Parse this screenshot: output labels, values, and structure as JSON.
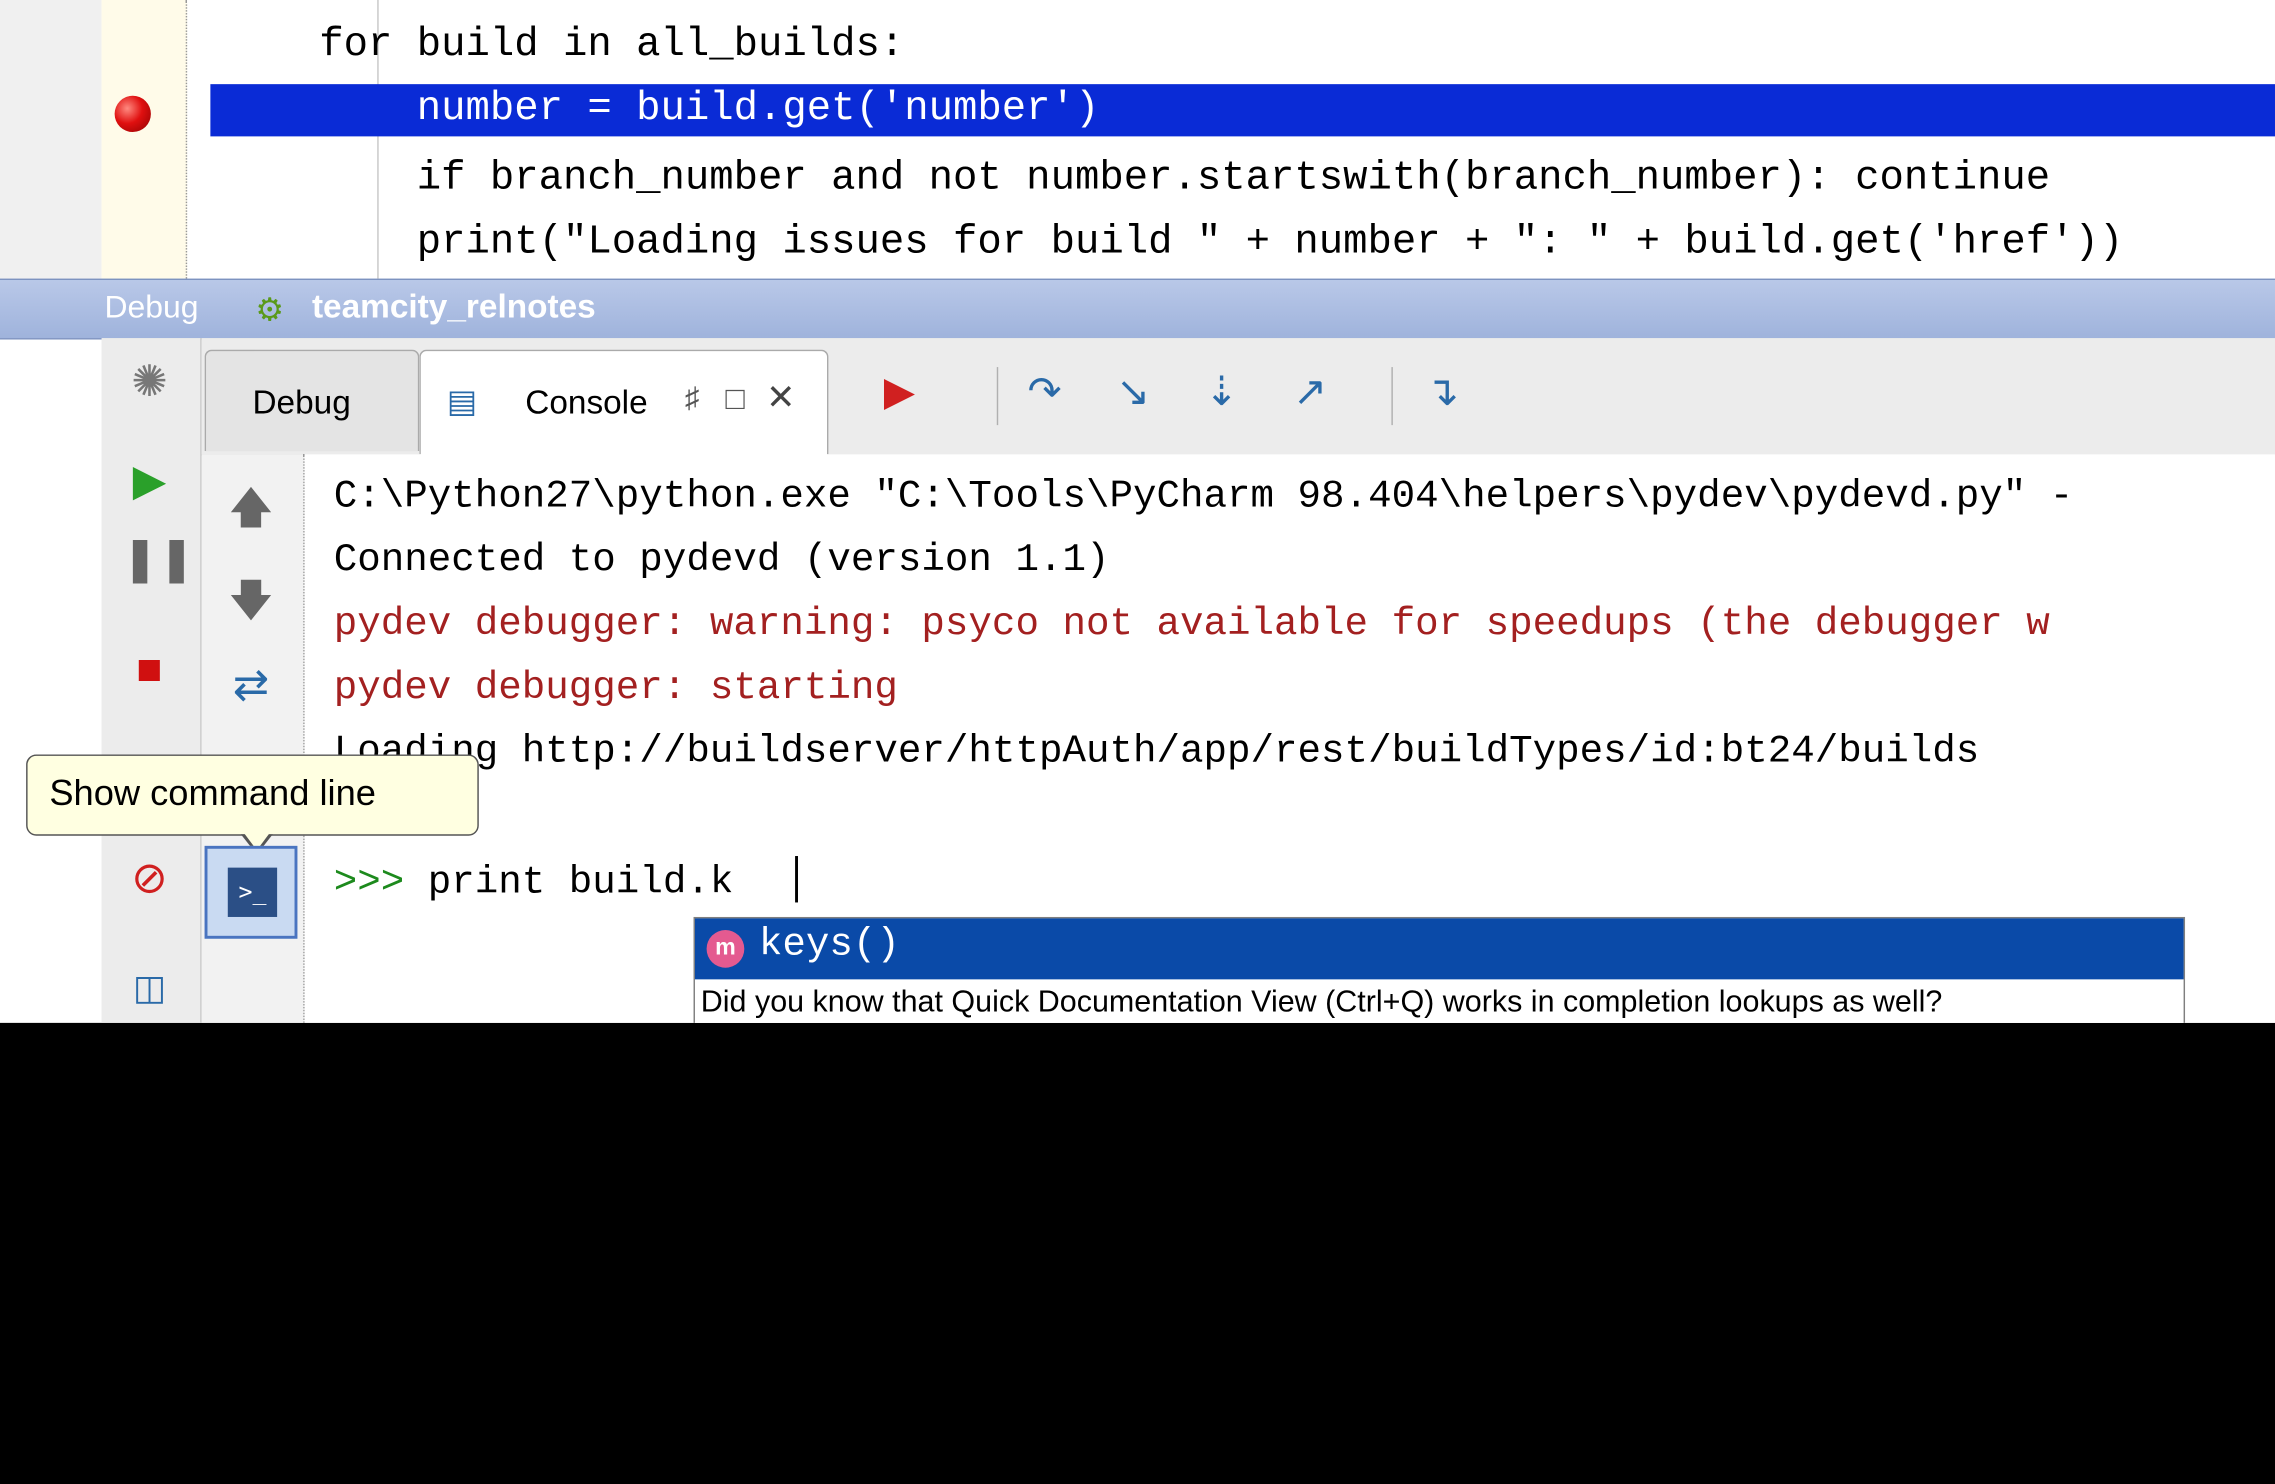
{
  "editor": {
    "lines": [
      "for build in all_builds:",
      "    number = build.get('number')",
      "    if branch_number and not number.startswith(branch_number): continue",
      "    print(\"Loading issues for build \" + number + \": \" + build.get('href'))"
    ]
  },
  "debug_panel": {
    "label": "Debug",
    "config_name": "teamcity_relnotes",
    "tabs": [
      {
        "label": "Debug"
      },
      {
        "label": "Console"
      }
    ]
  },
  "console": {
    "lines": [
      {
        "text": "C:\\Python27\\python.exe \"C:\\Tools\\PyCharm 98.404\\helpers\\pydev\\pydevd.py\" -",
        "color": "#000000"
      },
      {
        "text": "Connected to pydevd (version 1.1)",
        "color": "#000000"
      },
      {
        "text": "pydev debugger: warning: psyco not available for speedups (the debugger w",
        "color": "#a32020"
      },
      {
        "text": "pydev debugger: starting",
        "color": "#a32020"
      },
      {
        "text": "Loading http://buildserver/httpAuth/app/rest/buildTypes/id:bt24/builds",
        "color": "#000000"
      }
    ],
    "prompt": ">>>",
    "input": " print build.k"
  },
  "completion": {
    "item_badge": "m",
    "item": "keys()",
    "hint": "Did you know that Quick Documentation View (Ctrl+Q) works in completion lookups as well?"
  },
  "tooltip": {
    "text": "Show command line"
  }
}
